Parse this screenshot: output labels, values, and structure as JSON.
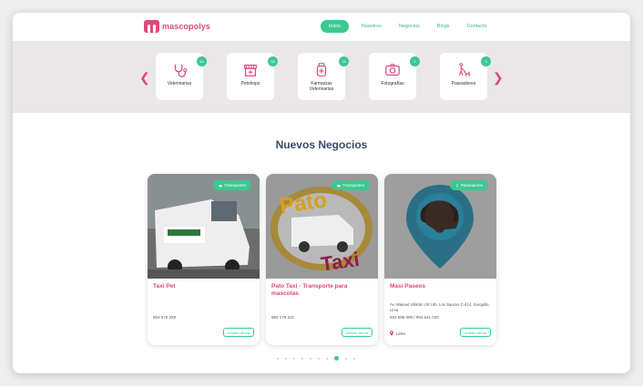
{
  "brand": {
    "name": "mascopolys",
    "color": "#e0477a",
    "accent": "#3cc891"
  },
  "nav": {
    "items": [
      {
        "label": "Inicio",
        "active": true
      },
      {
        "label": "Nosotros",
        "active": false
      },
      {
        "label": "Negocios",
        "active": false
      },
      {
        "label": "Blogs",
        "active": false
      },
      {
        "label": "Contacto",
        "active": false
      }
    ]
  },
  "categories": [
    {
      "label": "Veterinarias",
      "count": "44",
      "icon": "stethoscope-icon"
    },
    {
      "label": "Petshops",
      "count": "33",
      "icon": "shop-icon"
    },
    {
      "label": "Farmacias Veterinarias",
      "count": "15",
      "icon": "medicine-bottle-icon"
    },
    {
      "label": "Fotografías",
      "count": "1",
      "icon": "camera-icon"
    },
    {
      "label": "Paseadores",
      "count": "3",
      "icon": "dog-walker-icon"
    }
  ],
  "section_title": "Nuevos Negocios",
  "businesses": [
    {
      "tag": "Transportes",
      "name": "Taxi Pet",
      "address": "",
      "phone": "954 670 229",
      "district": "",
      "status": "Abierto ahora"
    },
    {
      "tag": "Transportes",
      "name": "Pato Taxi - Transporte para mascotas",
      "address": "",
      "phone": "990 179 311",
      "district": "",
      "status": "Abierto ahora"
    },
    {
      "tag": "Paseadores",
      "name": "Masi Paseos",
      "address": "Av. Manuel Villarán c/8 Urb. Los Sauces C-414, Surquillo, Lima",
      "phone": "922 696 009 / 994 641 020",
      "district": "Lima",
      "status": "Abierto ahora"
    }
  ],
  "pagination": {
    "total": 9,
    "active": 7
  }
}
